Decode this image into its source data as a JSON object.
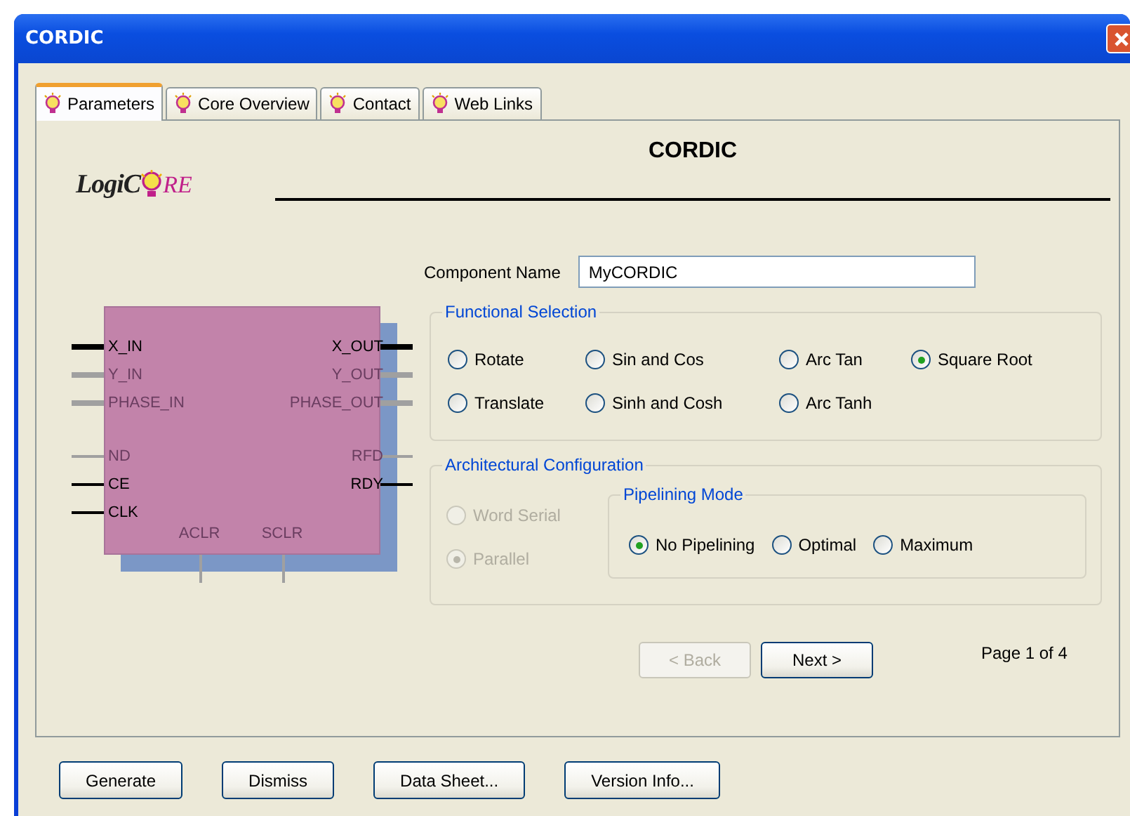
{
  "window": {
    "title": "CORDIC"
  },
  "tabs": [
    {
      "label": "Parameters",
      "selected": true
    },
    {
      "label": "Core Overview",
      "selected": false
    },
    {
      "label": "Contact",
      "selected": false
    },
    {
      "label": "Web Links",
      "selected": false
    }
  ],
  "header": {
    "logo_left": "LogiC",
    "logo_right": "RE",
    "title": "CORDIC"
  },
  "symbol": {
    "left_port_groups": [
      [
        {
          "label": "X_IN",
          "kind": "bus",
          "enabled": true
        },
        {
          "label": "Y_IN",
          "kind": "bus",
          "enabled": false
        },
        {
          "label": "PHASE_IN",
          "kind": "bus",
          "enabled": false
        }
      ],
      [
        {
          "label": "ND",
          "kind": "signal",
          "enabled": false
        },
        {
          "label": "CE",
          "kind": "signal",
          "enabled": true
        },
        {
          "label": "CLK",
          "kind": "signal",
          "enabled": true
        }
      ]
    ],
    "right_port_groups": [
      [
        {
          "label": "X_OUT",
          "kind": "bus",
          "enabled": true
        },
        {
          "label": "Y_OUT",
          "kind": "bus",
          "enabled": false
        },
        {
          "label": "PHASE_OUT",
          "kind": "bus",
          "enabled": false
        }
      ],
      [
        {
          "label": "RFD",
          "kind": "signal",
          "enabled": false
        },
        {
          "label": "RDY",
          "kind": "signal",
          "enabled": true
        }
      ]
    ],
    "bottom_ports": [
      {
        "label": "ACLR",
        "enabled": false
      },
      {
        "label": "SCLR",
        "enabled": false
      }
    ]
  },
  "component_name": {
    "label": "Component Name",
    "value": "MyCORDIC"
  },
  "functional_selection": {
    "title": "Functional Selection",
    "options": [
      {
        "label": "Rotate",
        "selected": false
      },
      {
        "label": "Sin and Cos",
        "selected": false
      },
      {
        "label": "Arc Tan",
        "selected": false
      },
      {
        "label": "Square Root",
        "selected": true
      },
      {
        "label": "Translate",
        "selected": false
      },
      {
        "label": "Sinh and Cosh",
        "selected": false
      },
      {
        "label": "Arc Tanh",
        "selected": false
      }
    ]
  },
  "architectural_configuration": {
    "title": "Architectural Configuration",
    "options": [
      {
        "label": "Word Serial",
        "selected": false,
        "disabled": true
      },
      {
        "label": "Parallel",
        "selected": true,
        "disabled": true
      }
    ],
    "pipelining_mode": {
      "title": "Pipelining Mode",
      "options": [
        {
          "label": "No Pipelining",
          "selected": true
        },
        {
          "label": "Optimal",
          "selected": false
        },
        {
          "label": "Maximum",
          "selected": false
        }
      ]
    }
  },
  "navigation": {
    "back": {
      "label": "< Back",
      "disabled": true
    },
    "next": {
      "label": "Next >",
      "disabled": false
    },
    "page": "Page 1 of 4"
  },
  "buttons": [
    "Generate",
    "Dismiss",
    "Data Sheet...",
    "Version Info..."
  ]
}
